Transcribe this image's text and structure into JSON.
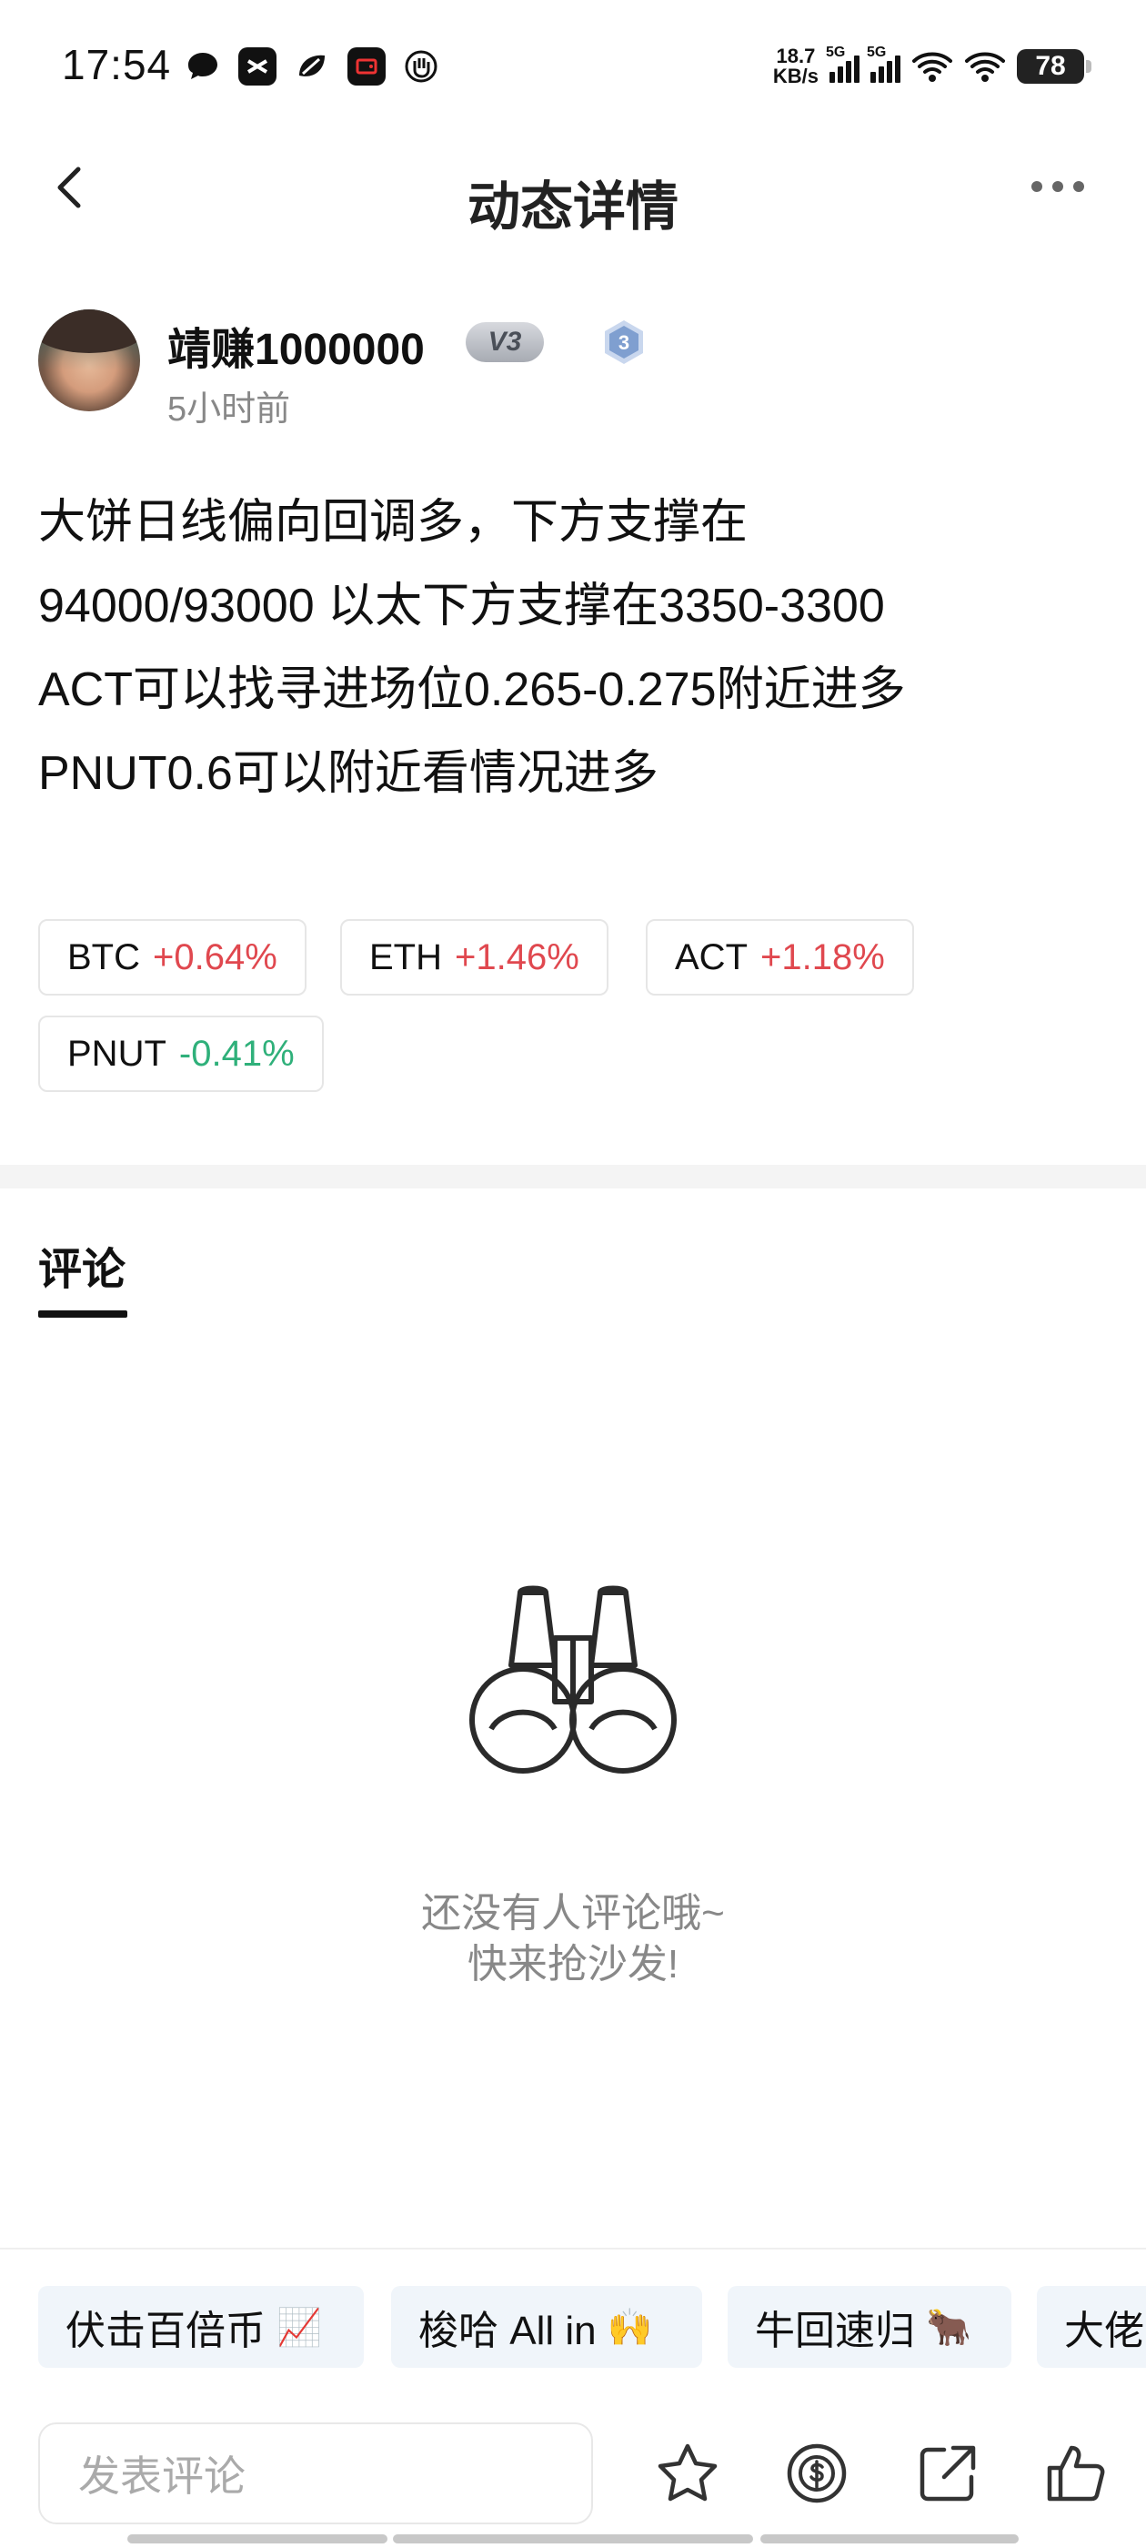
{
  "status_bar": {
    "time": "17:54",
    "icons": [
      "chat-bubble-icon",
      "capcut-icon",
      "leaf-app-icon",
      "video-app-icon",
      "hand-app-icon"
    ],
    "net_speed_value": "18.7",
    "net_speed_unit": "KB/s",
    "signal1_label": "5G",
    "signal2_label": "5G",
    "battery": "78"
  },
  "navbar": {
    "title": "动态详情"
  },
  "author": {
    "name": "靖赚1000000",
    "vip_badge": "V3",
    "level_badge": "3",
    "time": "5小时前"
  },
  "post": {
    "lines": [
      "大饼日线偏向回调多，下方支撑在",
      "94000/93000 以太下方支撑在3350-3300",
      "ACT可以找寻进场位0.265-0.275附近进多",
      "PNUT0.6可以附近看情况进多"
    ]
  },
  "tickers": [
    {
      "symbol": "BTC",
      "change": "+0.64%",
      "direction": "up"
    },
    {
      "symbol": "ETH",
      "change": "+1.46%",
      "direction": "up"
    },
    {
      "symbol": "ACT",
      "change": "+1.18%",
      "direction": "up"
    },
    {
      "symbol": "PNUT",
      "change": "-0.41%",
      "direction": "down"
    }
  ],
  "comments": {
    "tab_label": "评论",
    "empty_line1": "还没有人评论哦~",
    "empty_line2": "快来抢沙发!"
  },
  "quick_replies": [
    {
      "label": "伏击百倍币",
      "emoji": "📈"
    },
    {
      "label": "梭哈 All in",
      "emoji": "🙌"
    },
    {
      "label": "牛回速归",
      "emoji": "🐂"
    },
    {
      "label": "大佬",
      "emoji": ""
    }
  ],
  "bottom_bar": {
    "input_placeholder": "发表评论",
    "actions": [
      "star-icon",
      "tip-coin-icon",
      "share-icon",
      "like-icon"
    ]
  },
  "colors": {
    "up": "#e0484f",
    "down": "#2fb07a",
    "text": "#111111",
    "muted": "#888888"
  }
}
